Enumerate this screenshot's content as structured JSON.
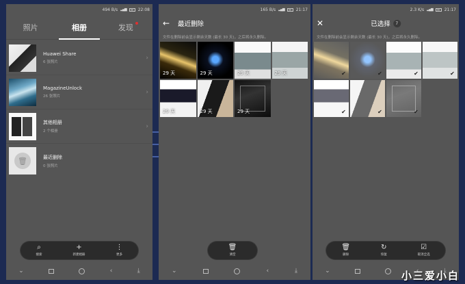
{
  "left": {
    "status": {
      "speed": "494 B/s",
      "time": "22:08"
    },
    "tabs": [
      {
        "label": "照片"
      },
      {
        "label": "相册"
      },
      {
        "label": "发现"
      }
    ],
    "albums": [
      {
        "name": "Huawei Share",
        "count": "6 张照片"
      },
      {
        "name": "MagazineUnlock",
        "count": "26 张照片"
      },
      {
        "name": "其他相册",
        "count": "2 个相册"
      },
      {
        "name": "最近删除",
        "count": "0 张照片"
      }
    ],
    "bottom_actions": [
      {
        "label": "搜索"
      },
      {
        "label": "新建相册"
      },
      {
        "label": "更多"
      }
    ]
  },
  "middle": {
    "status": {
      "speed": "165 B/s",
      "time": "21:17"
    },
    "title": "最近删除",
    "info": "文件在删除前会显示剩余天数 (最长 30 天)，之后将永久删除。",
    "items": [
      {
        "days": "29 天"
      },
      {
        "days": "29 天"
      },
      {
        "days": "29 天"
      },
      {
        "days": "29 天"
      },
      {
        "days": "29 天"
      },
      {
        "days": "29 天"
      },
      {
        "days": "29 天"
      }
    ],
    "action": {
      "label": "清空"
    }
  },
  "right": {
    "status": {
      "speed": "2.3 K/s",
      "time": "21:17"
    },
    "title": "已选择",
    "count": "7",
    "info": "文件在删除前会显示剩余天数 (最长 30 天)，之后将永久删除。",
    "items": [
      {
        "days": ""
      },
      {
        "days": ""
      },
      {
        "days": ""
      },
      {
        "days": ""
      },
      {
        "days": ""
      },
      {
        "days": ""
      },
      {
        "days": ""
      }
    ],
    "actions": [
      {
        "label": "删除"
      },
      {
        "label": "恢复"
      },
      {
        "label": "取消全选"
      }
    ]
  },
  "watermark": "小三爱小白"
}
